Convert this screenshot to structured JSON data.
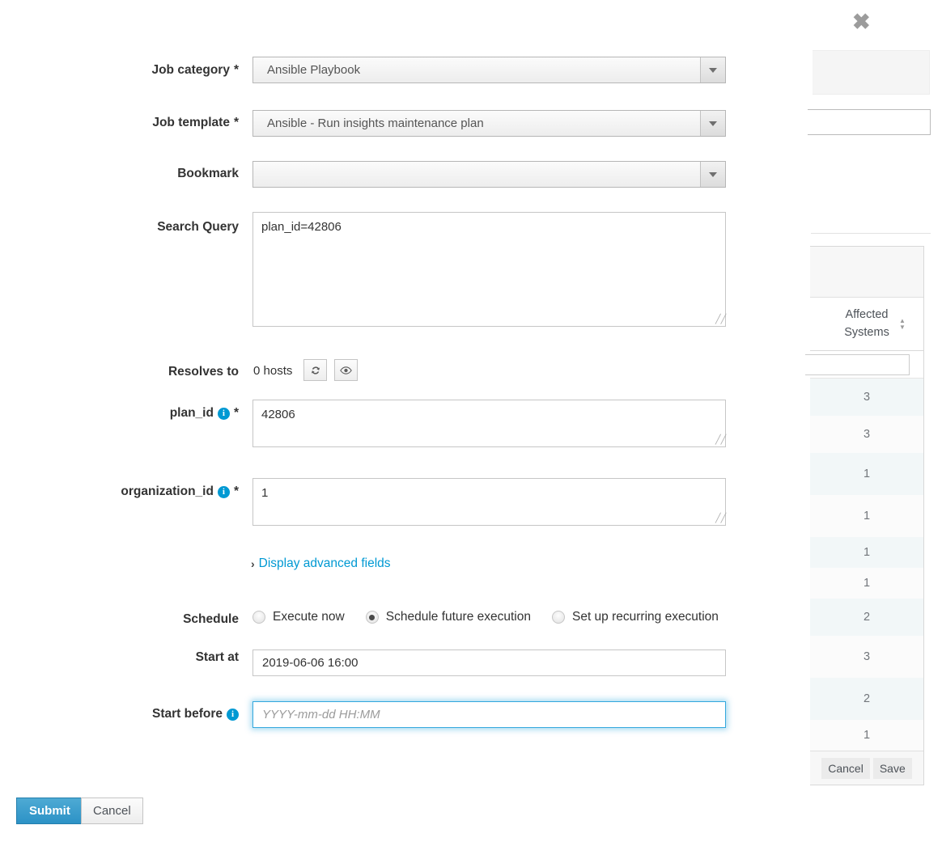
{
  "background": {
    "close_label": "✖",
    "table": {
      "column_header": "Affected Systems",
      "rows": [
        {
          "affected_systems": "3"
        },
        {
          "affected_systems": "3"
        },
        {
          "affected_systems": "1"
        },
        {
          "affected_systems": "1"
        },
        {
          "affected_systems": "1"
        },
        {
          "affected_systems": "1"
        },
        {
          "affected_systems": "2"
        },
        {
          "affected_systems": "3"
        },
        {
          "affected_systems": "2"
        },
        {
          "affected_systems": "1"
        }
      ],
      "footer": {
        "cancel_label": "Cancel",
        "save_label": "Save"
      }
    }
  },
  "form": {
    "job_category": {
      "label": "Job category",
      "required_marker": "*",
      "value": "Ansible Playbook"
    },
    "job_template": {
      "label": "Job template",
      "required_marker": "*",
      "value": "Ansible - Run insights maintenance plan"
    },
    "bookmark": {
      "label": "Bookmark",
      "value": ""
    },
    "search_query": {
      "label": "Search Query",
      "value": "plan_id=42806"
    },
    "resolves_to": {
      "label": "Resolves to",
      "value": "0 hosts",
      "refresh_title": "Refresh",
      "preview_title": "Preview hosts"
    },
    "plan_id": {
      "label": "plan_id",
      "info_glyph": "i",
      "required_marker": "*",
      "value": "42806"
    },
    "organization_id": {
      "label": "organization_id",
      "info_glyph": "i",
      "required_marker": "*",
      "value": "1"
    },
    "advanced": {
      "chevron": "›",
      "link_label": "Display advanced fields"
    },
    "schedule": {
      "label": "Schedule",
      "options": [
        {
          "label": "Execute now",
          "checked": false
        },
        {
          "label": "Schedule future execution",
          "checked": true
        },
        {
          "label": "Set up recurring execution",
          "checked": false
        }
      ]
    },
    "start_at": {
      "label": "Start at",
      "value": "2019-06-06 16:00",
      "placeholder": ""
    },
    "start_before": {
      "label": "Start before",
      "info_glyph": "i",
      "value": "",
      "placeholder": "YYYY-mm-dd HH:MM",
      "focused": true
    },
    "actions": {
      "submit_label": "Submit",
      "cancel_label": "Cancel"
    }
  },
  "colors": {
    "accent_blue": "#0099d3",
    "submit_blue": "#2c92c6",
    "focus_ring": "#33a8dd",
    "label_text": "#333333",
    "row_alt": "#f2f7f8"
  }
}
